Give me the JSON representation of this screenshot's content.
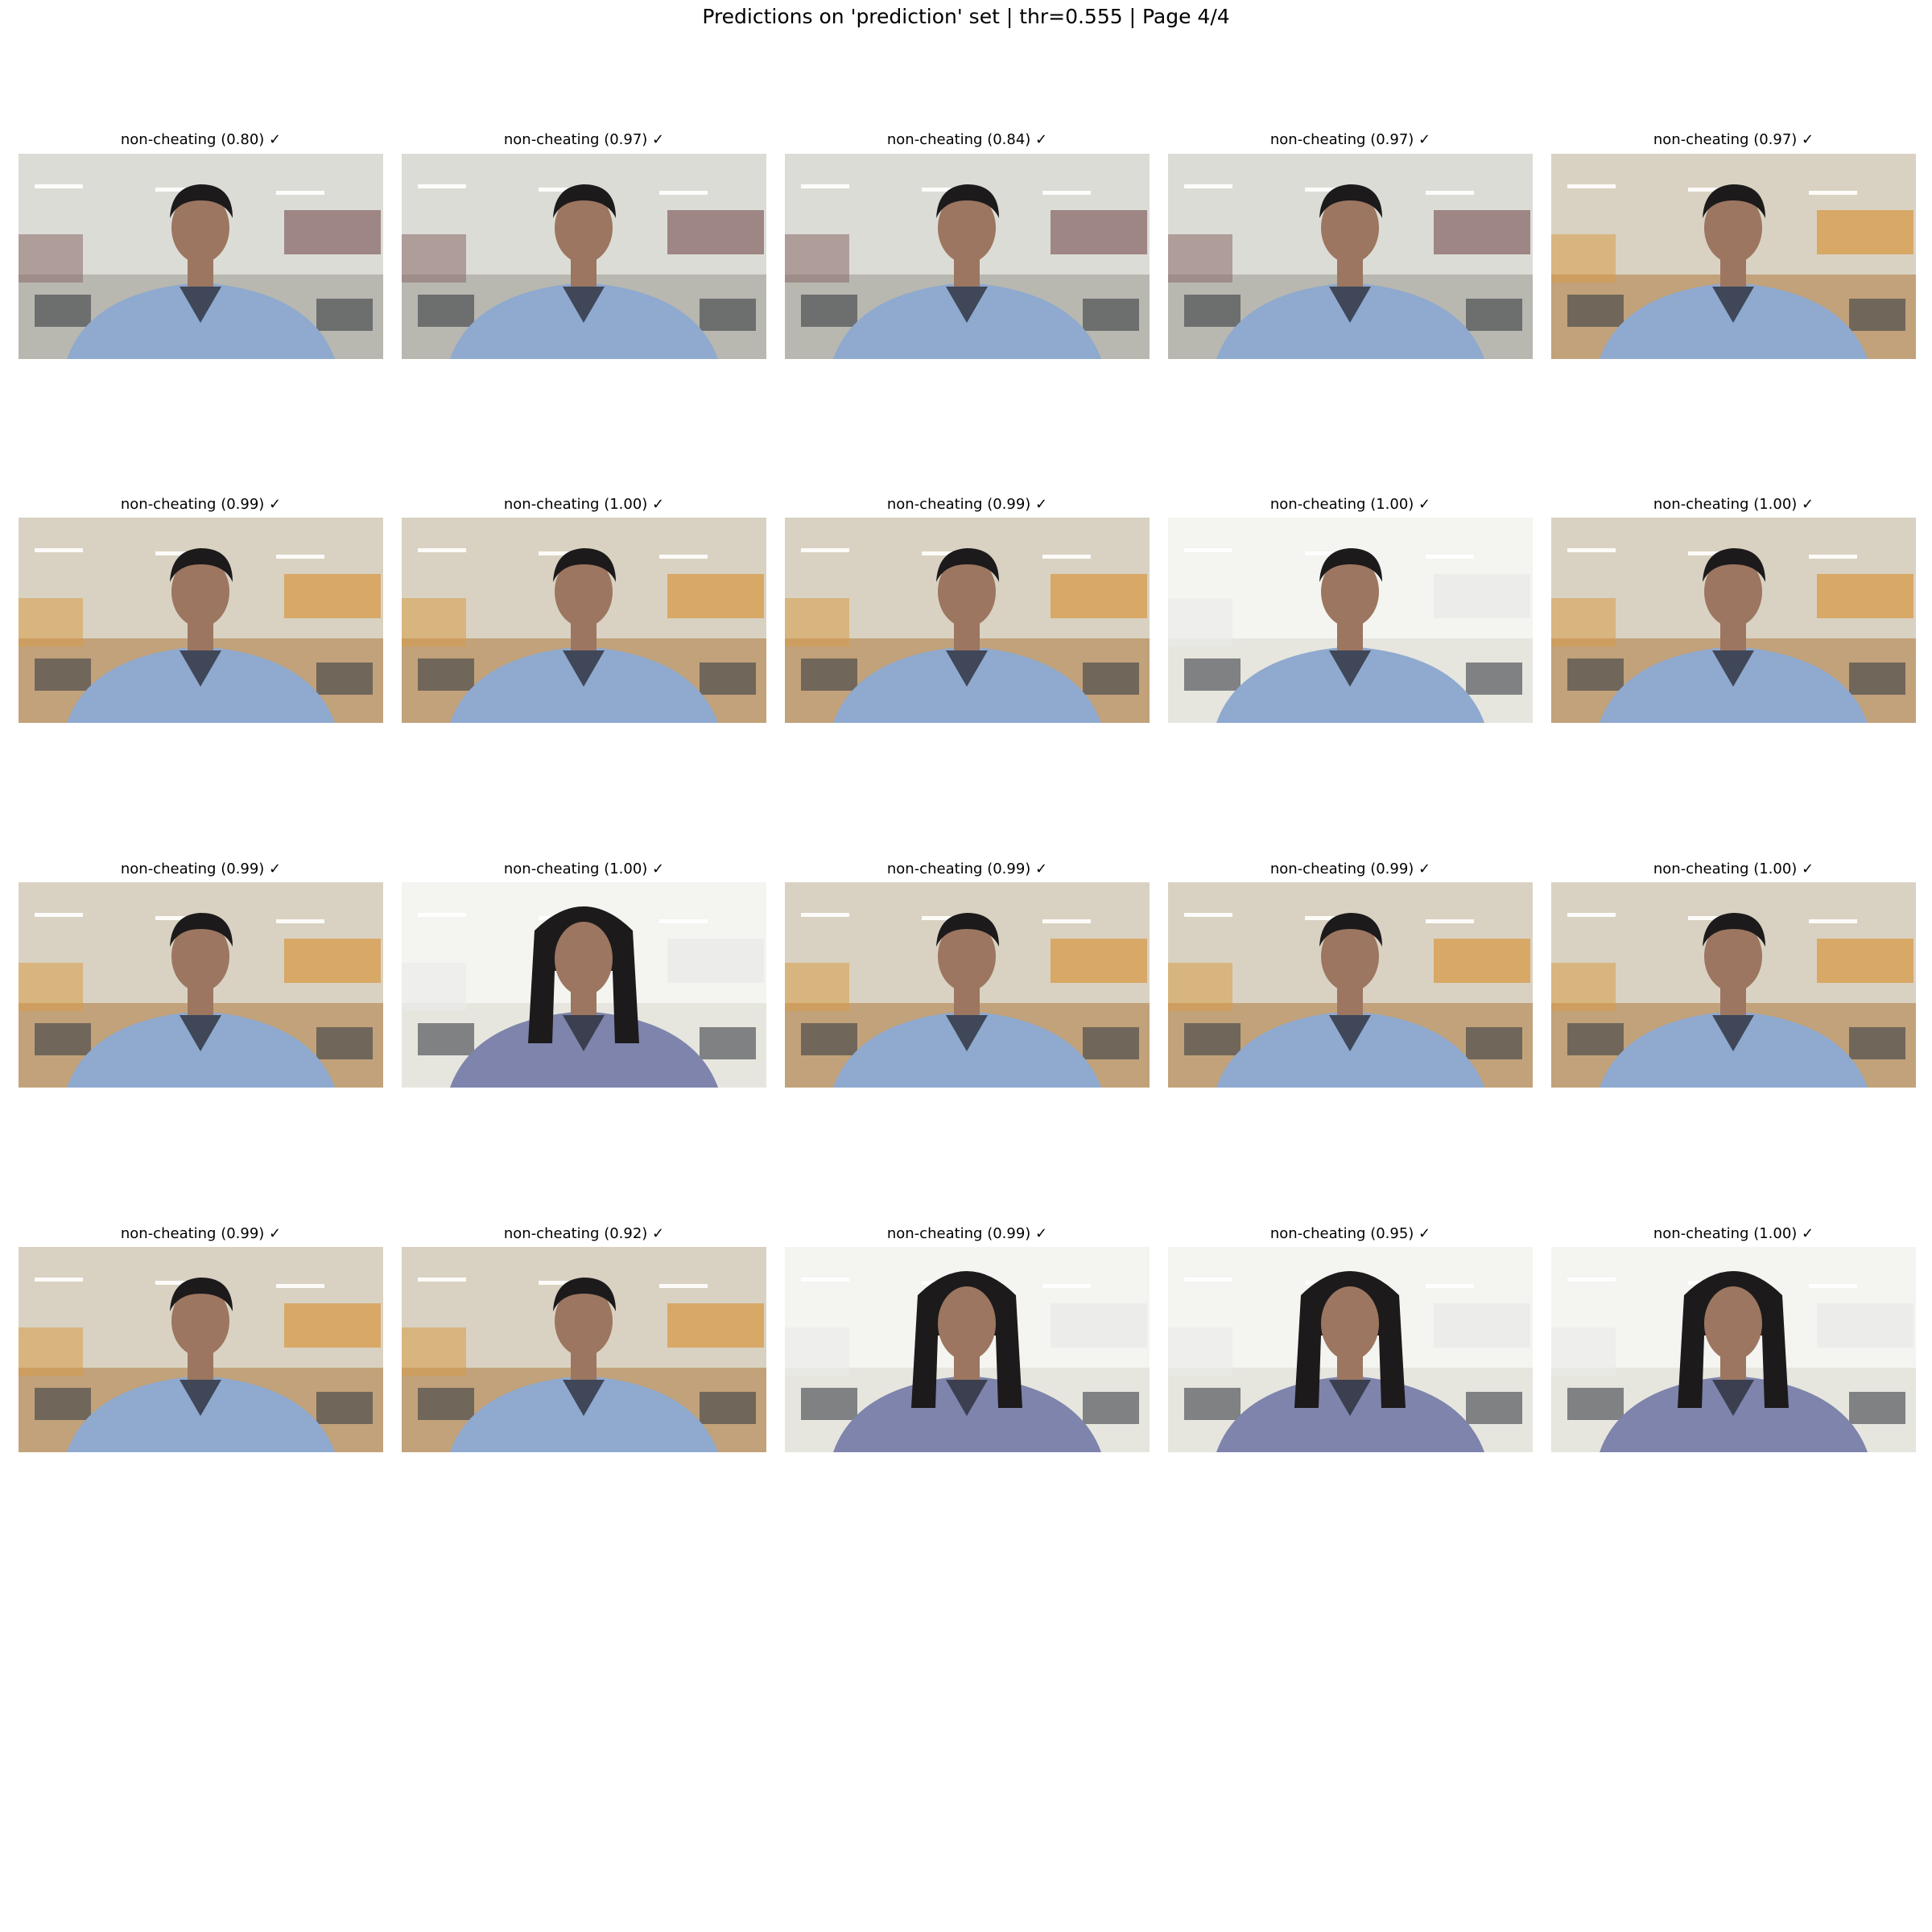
{
  "figure": {
    "title": "Predictions on 'prediction' set  |  thr=0.555  |  Page 4/4"
  },
  "rows": [
    [
      {
        "label": "non-cheating (0.80) ✓",
        "scene": "dim",
        "subject": "male"
      },
      {
        "label": "non-cheating (0.97) ✓",
        "scene": "dim",
        "subject": "male"
      },
      {
        "label": "non-cheating (0.84) ✓",
        "scene": "dim",
        "subject": "male"
      },
      {
        "label": "non-cheating (0.97) ✓",
        "scene": "dim",
        "subject": "male"
      },
      {
        "label": "non-cheating (0.97) ✓",
        "scene": "warm",
        "subject": "male"
      }
    ],
    [
      {
        "label": "non-cheating (0.99) ✓",
        "scene": "warm",
        "subject": "male"
      },
      {
        "label": "non-cheating (1.00) ✓",
        "scene": "warm",
        "subject": "male"
      },
      {
        "label": "non-cheating (0.99) ✓",
        "scene": "warm",
        "subject": "male"
      },
      {
        "label": "non-cheating (1.00) ✓",
        "scene": "bright",
        "subject": "male"
      },
      {
        "label": "non-cheating (1.00) ✓",
        "scene": "warm",
        "subject": "male"
      }
    ],
    [
      {
        "label": "non-cheating (0.99) ✓",
        "scene": "warm",
        "subject": "male"
      },
      {
        "label": "non-cheating (1.00) ✓",
        "scene": "bright",
        "subject": "female"
      },
      {
        "label": "non-cheating (0.99) ✓",
        "scene": "warm",
        "subject": "male"
      },
      {
        "label": "non-cheating (0.99) ✓",
        "scene": "warm",
        "subject": "male"
      },
      {
        "label": "non-cheating (1.00) ✓",
        "scene": "warm",
        "subject": "male"
      }
    ],
    [
      {
        "label": "non-cheating (0.99) ✓",
        "scene": "warm",
        "subject": "male"
      },
      {
        "label": "non-cheating (0.92) ✓",
        "scene": "warm",
        "subject": "male"
      },
      {
        "label": "non-cheating (0.99) ✓",
        "scene": "bright",
        "subject": "female"
      },
      {
        "label": "non-cheating (0.95) ✓",
        "scene": "bright",
        "subject": "female"
      },
      {
        "label": "non-cheating (1.00) ✓",
        "scene": "bright",
        "subject": "female"
      }
    ]
  ],
  "colors": {
    "dim": {
      "wall": "#dcdcd6",
      "floor": "#b8b8b0",
      "window": "#8a6a6a"
    },
    "warm": {
      "wall": "#d9d2c2",
      "floor": "#c2a27a",
      "window": "#d79a48"
    },
    "bright": {
      "wall": "#f4f4f0",
      "floor": "#e6e6df",
      "window": "#eaeaea"
    },
    "shirt_male": "#8fa9cf",
    "shirt_female": "#7e84ab",
    "skin": "#9c7660",
    "hair": "#1d1a1c"
  }
}
